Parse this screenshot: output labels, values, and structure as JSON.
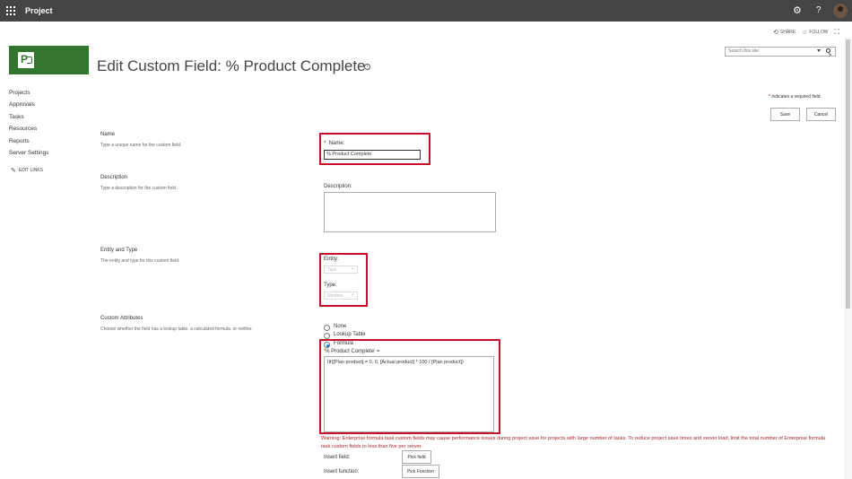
{
  "suite": {
    "app_title": "Project"
  },
  "actions": {
    "share": "SHARE",
    "follow": "FOLLOW"
  },
  "page": {
    "title": "Edit Custom Field: % Product Complete",
    "info": "i"
  },
  "search": {
    "placeholder": "Search this site"
  },
  "nav": {
    "items": [
      {
        "label": "Projects"
      },
      {
        "label": "Approvals"
      },
      {
        "label": "Tasks"
      },
      {
        "label": "Resources"
      },
      {
        "label": "Reports"
      },
      {
        "label": "Server Settings"
      }
    ],
    "edit_links": "EDIT LINKS"
  },
  "required_note": {
    "marker": "*",
    "text": " indicates a required field"
  },
  "buttons": {
    "save": "Save",
    "cancel": "Cancel"
  },
  "sections": {
    "name": {
      "title": "Name",
      "desc": "Type a unique name for the custom field.",
      "label": "Name:",
      "required": "*",
      "value": "% Product Complete"
    },
    "description": {
      "title": "Description",
      "desc": "Type a description for the custom field.",
      "label": "Description:",
      "value": ""
    },
    "entity_type": {
      "title": "Entity and Type",
      "desc": "The entity and type for this custom field.",
      "entity_label": "Entity:",
      "entity_value": "Task",
      "type_label": "Type:",
      "type_value": "Number"
    },
    "custom_attributes": {
      "title": "Custom Attributes",
      "desc": "Choose whether the field has a lookup table, a calculated formula, or neither.",
      "options": [
        {
          "label": "None",
          "selected": false
        },
        {
          "label": "Lookup Table",
          "selected": false
        },
        {
          "label": "Formula",
          "selected": true
        }
      ],
      "formula_label": "'% Product Complete' =",
      "formula_value": "IIf([Plan product] = 0, 0, [Actual product] * 100 / [Plan product])",
      "warning": "Warning: Enterprise formula task custom fields may cause performance issues during project save for projects with large number of tasks. To reduce project save times and server load, limit the total number of Enterprise formula task custom fields to less than five per server.",
      "insert_field_label": "Insert field:",
      "pick_field": "Pick field",
      "insert_function_label": "Insert function:",
      "pick_function": "Pick Function"
    }
  },
  "colors": {
    "suite_bar": "#444444",
    "brand_green": "#31752f",
    "highlight_red": "#c8102e",
    "warning_red": "#a4262c"
  }
}
